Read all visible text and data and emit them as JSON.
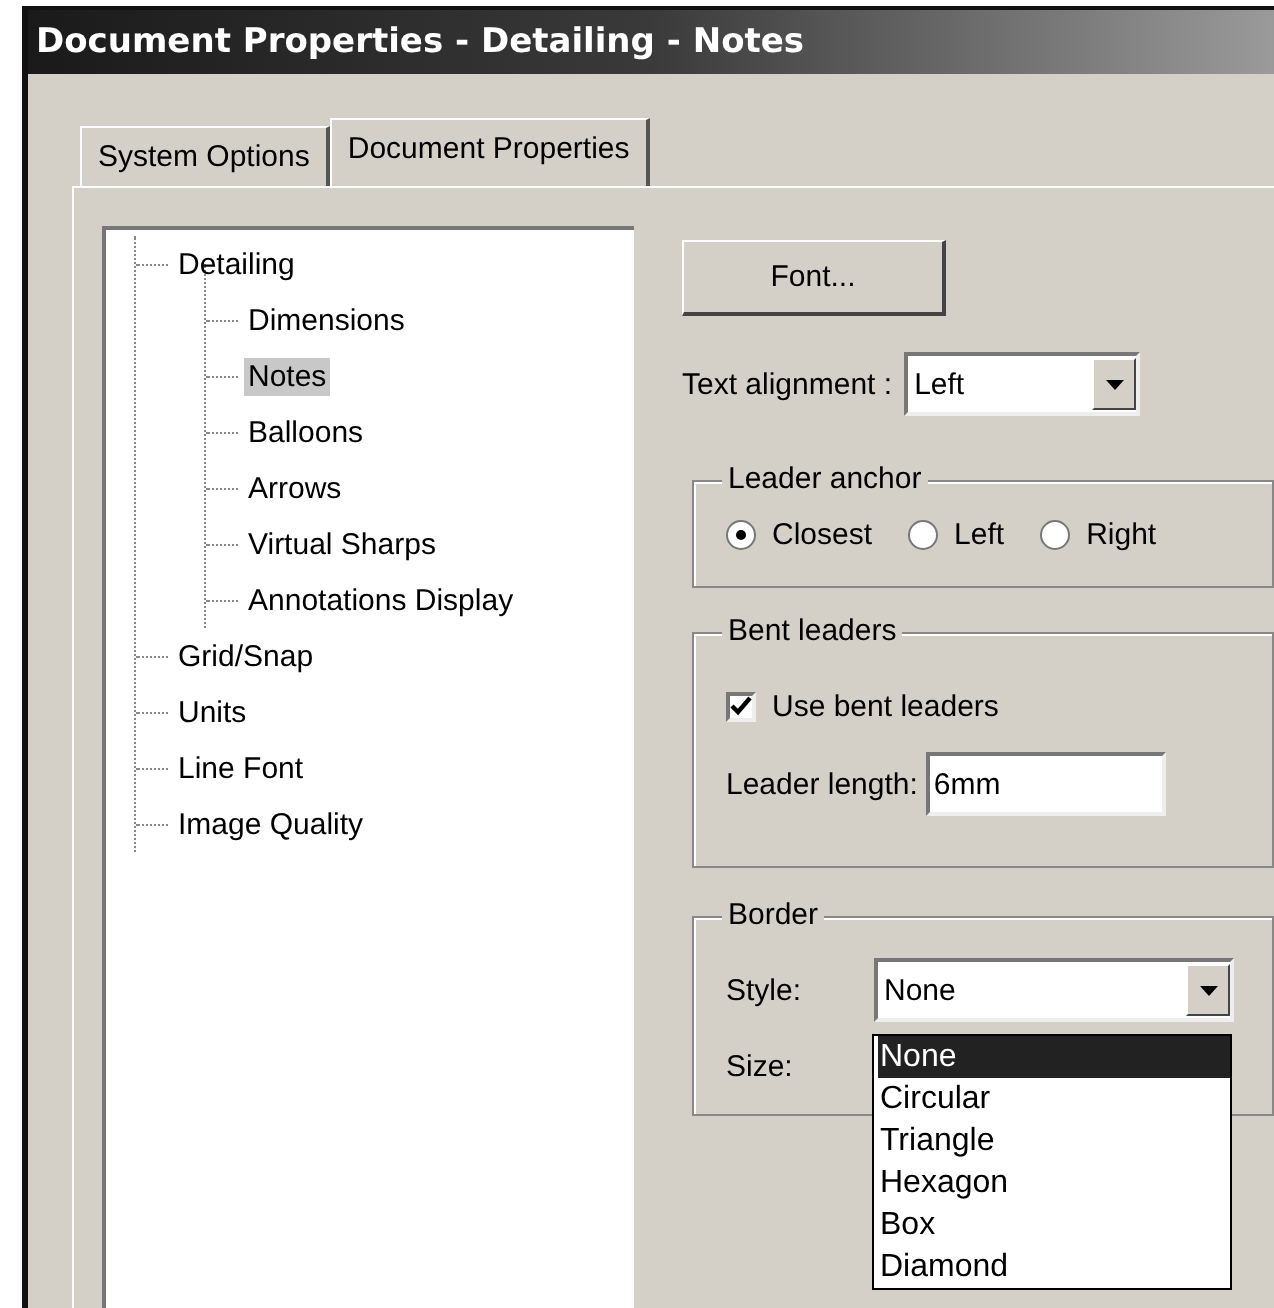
{
  "window": {
    "title": "Document Properties - Detailing - Notes"
  },
  "tabs": [
    {
      "label": "System Options",
      "selected": false
    },
    {
      "label": "Document Properties",
      "selected": true
    }
  ],
  "tree": [
    {
      "label": "Detailing",
      "selected": false,
      "children": [
        {
          "label": "Dimensions",
          "selected": false
        },
        {
          "label": "Notes",
          "selected": true
        },
        {
          "label": "Balloons",
          "selected": false
        },
        {
          "label": "Arrows",
          "selected": false
        },
        {
          "label": "Virtual Sharps",
          "selected": false
        },
        {
          "label": "Annotations Display",
          "selected": false
        }
      ]
    },
    {
      "label": "Grid/Snap",
      "selected": false
    },
    {
      "label": "Units",
      "selected": false
    },
    {
      "label": "Line Font",
      "selected": false
    },
    {
      "label": "Image Quality",
      "selected": false
    }
  ],
  "font_button": "Font...",
  "text_alignment": {
    "label": "Text alignment :",
    "value": "Left"
  },
  "leader_anchor": {
    "title": "Leader anchor",
    "options": [
      {
        "label": "Closest",
        "selected": true
      },
      {
        "label": "Left",
        "selected": false
      },
      {
        "label": "Right",
        "selected": false
      }
    ]
  },
  "bent_leaders": {
    "title": "Bent leaders",
    "checkbox": {
      "label": "Use bent leaders",
      "checked": true
    },
    "length": {
      "label": "Leader length:",
      "value": "6mm"
    }
  },
  "border": {
    "title": "Border",
    "style": {
      "label": "Style:",
      "value": "None",
      "expanded": true,
      "options": [
        {
          "label": "None",
          "selected": true
        },
        {
          "label": "Circular",
          "selected": false
        },
        {
          "label": "Triangle",
          "selected": false
        },
        {
          "label": "Hexagon",
          "selected": false
        },
        {
          "label": "Box",
          "selected": false
        },
        {
          "label": "Diamond",
          "selected": false
        }
      ]
    },
    "size": {
      "label": "Size:"
    }
  }
}
